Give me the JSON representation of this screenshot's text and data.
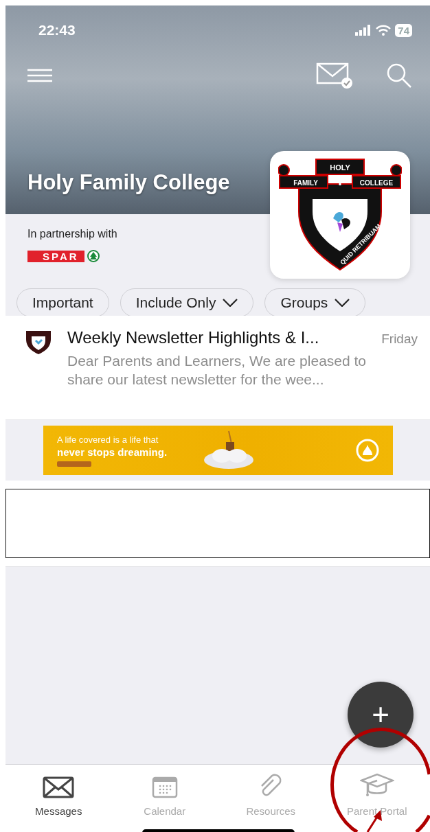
{
  "status_bar": {
    "time": "22:43",
    "battery": "74"
  },
  "header": {
    "title": "Holy Family College"
  },
  "crest": {
    "banner_top": "HOLY",
    "banner_left": "FAMILY",
    "banner_right": "COLLEGE",
    "motto": "QUID RETRIBUAM"
  },
  "partnership": {
    "label": "In partnership with",
    "sponsor": "SPAR"
  },
  "filters": [
    {
      "label": "Important",
      "kind": "toggle"
    },
    {
      "label": "Include Only",
      "kind": "dropdown"
    },
    {
      "label": "Groups",
      "kind": "dropdown"
    }
  ],
  "messages": [
    {
      "title": "Weekly Newsletter Highlights & I...",
      "date": "Friday",
      "preview": "Dear Parents and Learners, We are pleased to share our latest newsletter for the wee..."
    }
  ],
  "ad": {
    "line_1": "A life covered is a life that",
    "line_2": "never stops dreaming."
  },
  "fab": {
    "label": "+"
  },
  "tabs": [
    {
      "label": "Messages",
      "kind": "mail",
      "selected": true
    },
    {
      "label": "Calendar",
      "kind": "calendar",
      "selected": false
    },
    {
      "label": "Resources",
      "kind": "clip",
      "selected": false
    },
    {
      "label": "Parent Portal",
      "kind": "cap",
      "selected": false
    }
  ]
}
